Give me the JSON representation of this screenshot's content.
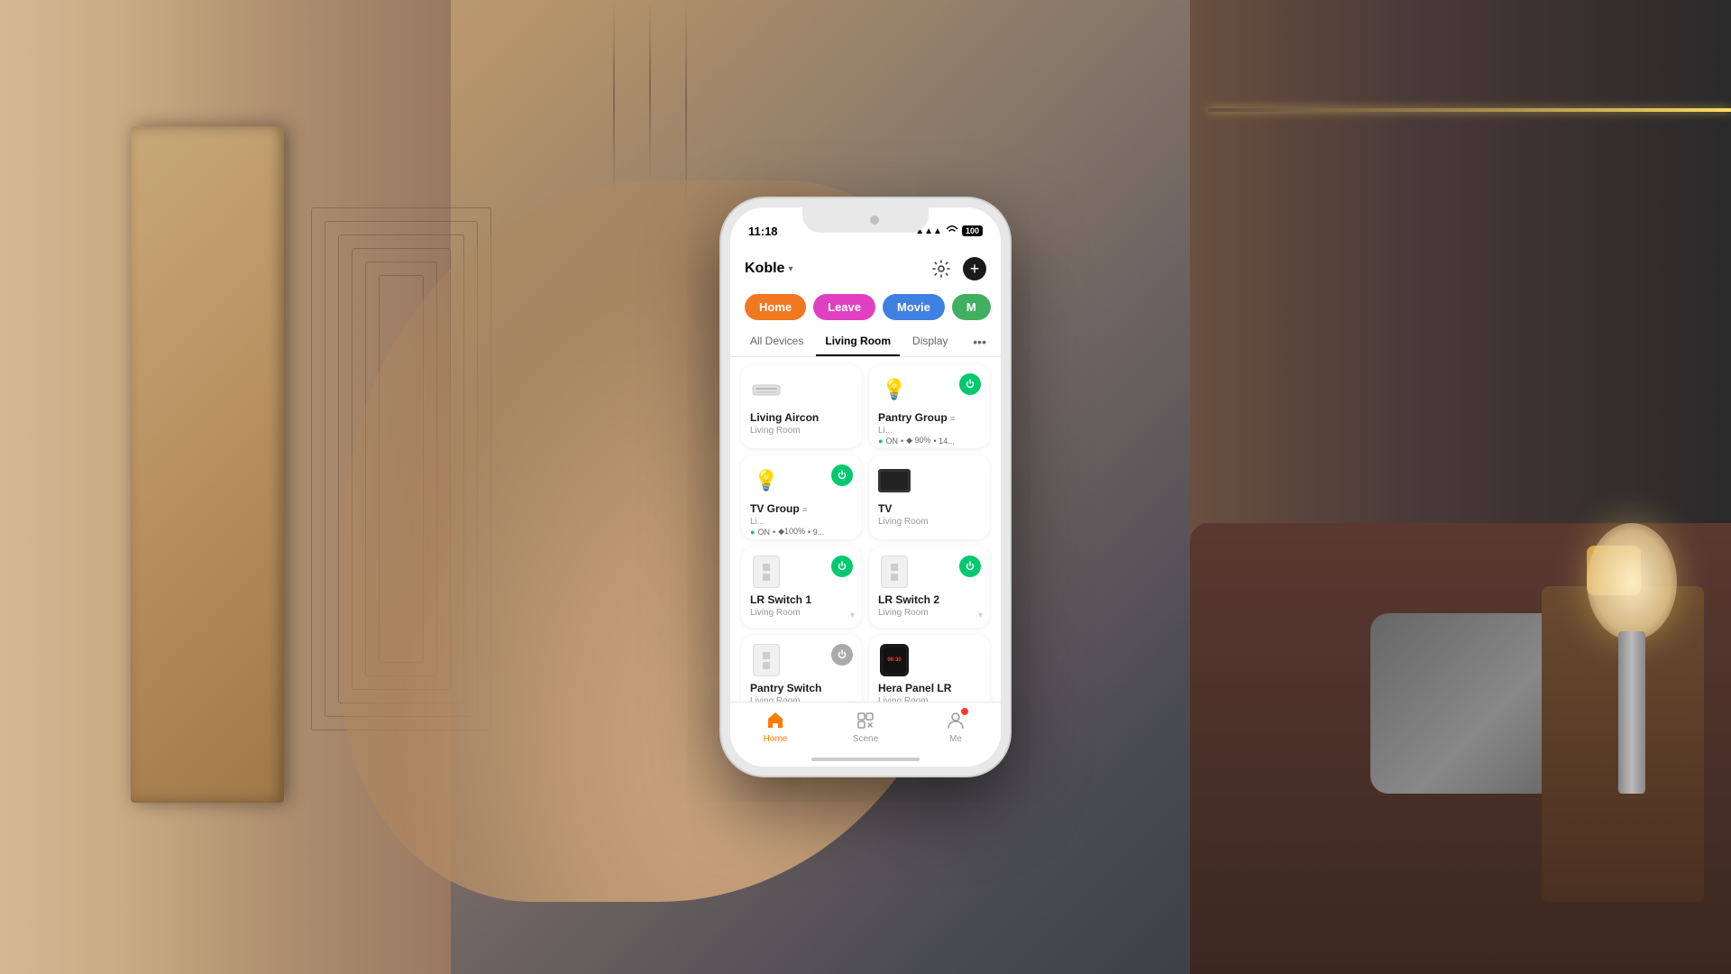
{
  "background": {
    "desc": "luxury interior room background"
  },
  "status_bar": {
    "time": "11:18",
    "signal": "▲",
    "wifi": "WiFi",
    "battery": "100"
  },
  "header": {
    "app_name": "Koble",
    "chevron": "▾",
    "gear_label": "settings",
    "plus_label": "add"
  },
  "scenes": [
    {
      "label": "Home",
      "color": "#f07820",
      "active": true
    },
    {
      "label": "Leave",
      "color": "#e040c0"
    },
    {
      "label": "Movie",
      "color": "#4080e0"
    },
    {
      "label": "M",
      "color": "#40b060"
    }
  ],
  "tabs": [
    {
      "label": "All Devices",
      "active": false
    },
    {
      "label": "Living Room",
      "active": true
    },
    {
      "label": "Display",
      "active": false
    }
  ],
  "devices": [
    {
      "name": "Living Aircon",
      "room": "Living Room",
      "type": "aircon",
      "power": "off",
      "status": ""
    },
    {
      "name": "Pantry Group",
      "room": "Living Room",
      "type": "light-group",
      "power": "on",
      "status": "ON • 90% • 14..."
    },
    {
      "name": "TV Group",
      "room": "Living Room",
      "type": "light-group",
      "power": "on",
      "status": "ON • 100% • 9..."
    },
    {
      "name": "TV",
      "room": "Living Room",
      "type": "tv",
      "power": "off",
      "status": ""
    },
    {
      "name": "LR Switch 1",
      "room": "Living Room",
      "type": "switch",
      "power": "on",
      "status": ""
    },
    {
      "name": "LR Switch 2",
      "room": "Living Room",
      "type": "switch",
      "power": "on",
      "status": ""
    },
    {
      "name": "Pantry Switch",
      "room": "Living Room",
      "type": "switch",
      "power": "off",
      "status": ""
    },
    {
      "name": "Hera Panel LR",
      "room": "Living Room",
      "type": "panel",
      "power": "off",
      "status": ""
    }
  ],
  "bottom_nav": [
    {
      "label": "Home",
      "icon": "home",
      "active": true,
      "badge": false
    },
    {
      "label": "Scene",
      "icon": "scene",
      "active": false,
      "badge": false
    },
    {
      "label": "Me",
      "icon": "me",
      "active": false,
      "badge": true
    }
  ]
}
